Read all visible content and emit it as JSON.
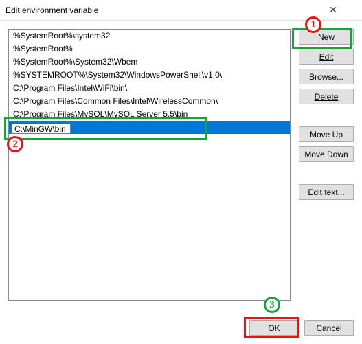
{
  "window": {
    "title": "Edit environment variable",
    "close_glyph": "✕"
  },
  "list": {
    "items": [
      "%SystemRoot%\\system32",
      "%SystemRoot%",
      "%SystemRoot%\\System32\\Wbem",
      "%SYSTEMROOT%\\System32\\WindowsPowerShell\\v1.0\\",
      "C:\\Program Files\\Intel\\WiFi\\bin\\",
      "C:\\Program Files\\Common Files\\Intel\\WirelessCommon\\",
      "C:\\Program Files\\MySQL\\MySQL Server 5.5\\bin"
    ],
    "selected_index": 7,
    "edit_value": "C:\\MinGW\\bin"
  },
  "buttons": {
    "new": "New",
    "edit": "Edit",
    "browse": "Browse...",
    "delete": "Delete",
    "moveup": "Move Up",
    "movedown": "Move Down",
    "edittext": "Edit text...",
    "ok": "OK",
    "cancel": "Cancel"
  },
  "annotations": {
    "b1": "1",
    "b2": "2",
    "b3": "3"
  }
}
